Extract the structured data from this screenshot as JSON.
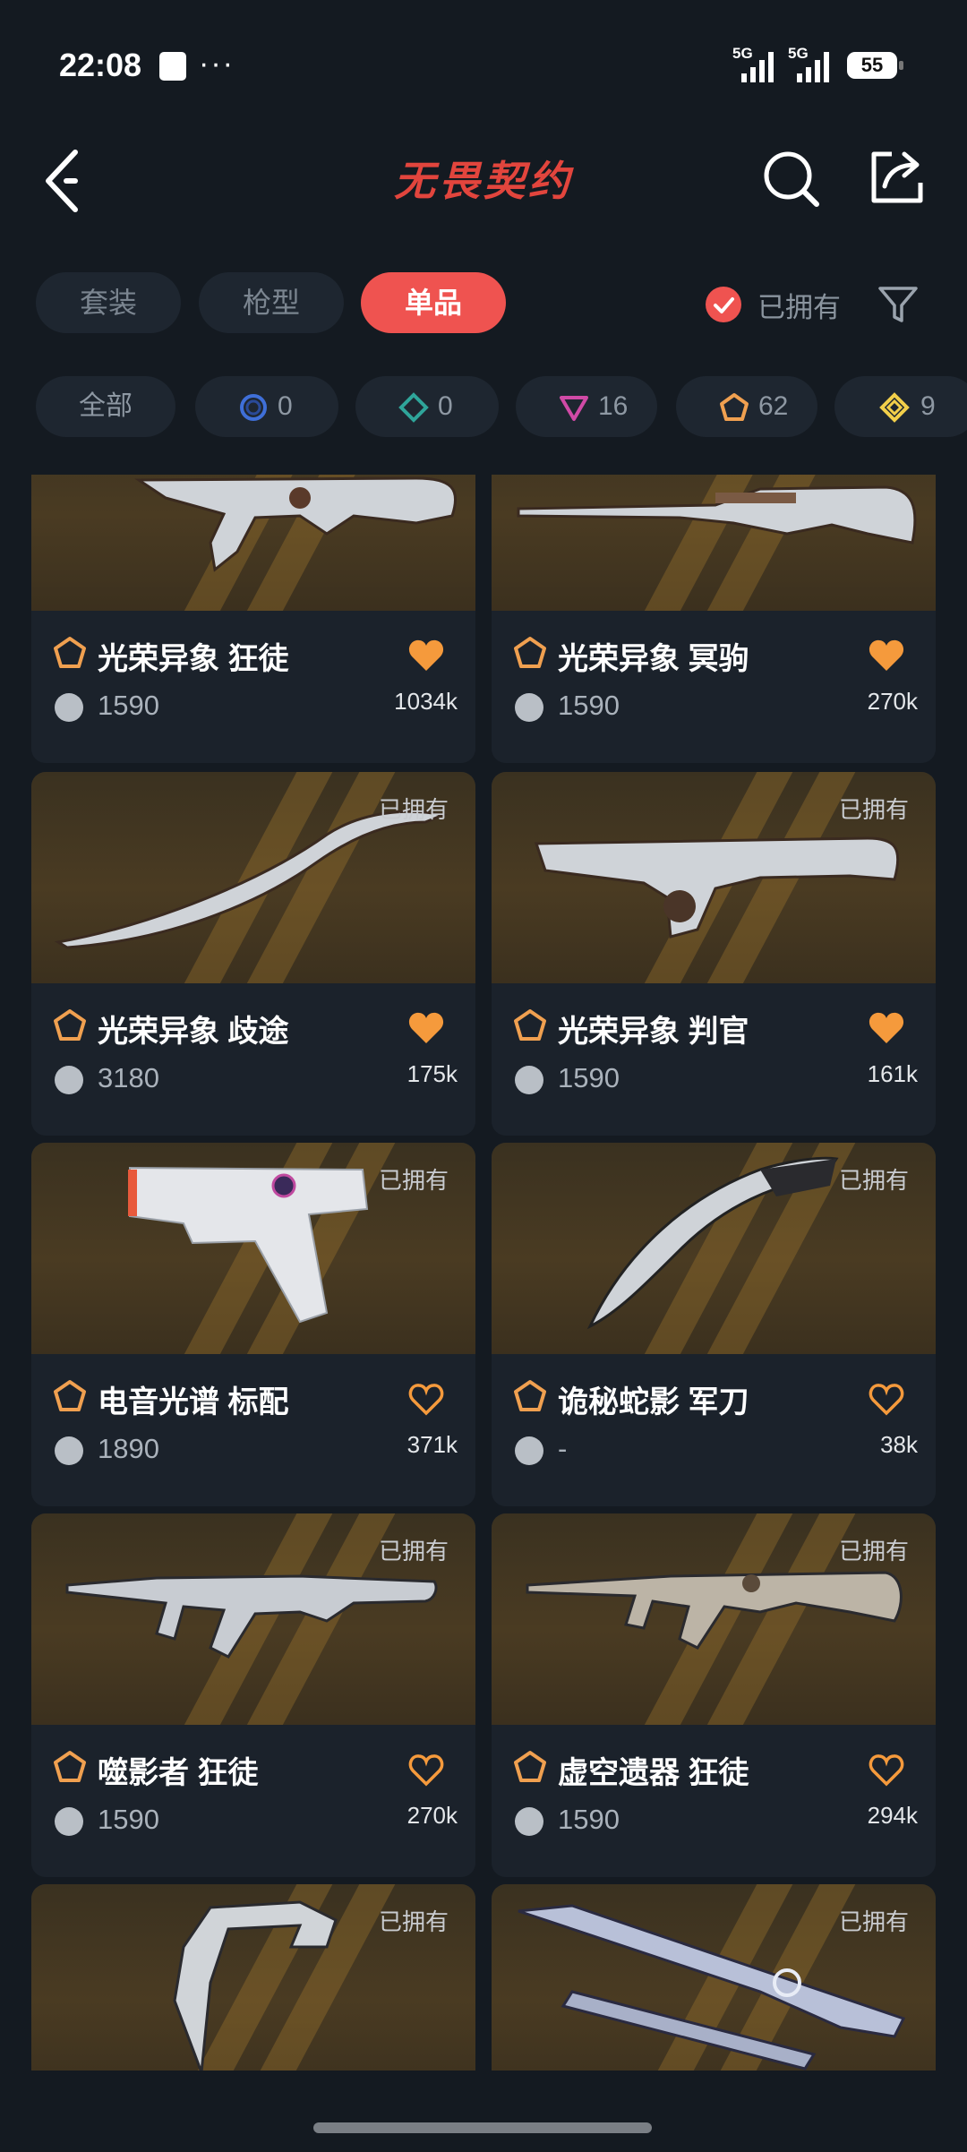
{
  "status": {
    "time": "22:08",
    "net1": "5G",
    "net2": "5G",
    "battery": "55"
  },
  "header": {
    "title": "无畏契约"
  },
  "tabs": [
    {
      "label": "套装"
    },
    {
      "label": "枪型"
    },
    {
      "label": "单品"
    }
  ],
  "owned_filter": {
    "label": "已拥有"
  },
  "rarity_filters": [
    {
      "label": "全部"
    },
    {
      "count": "0",
      "color": "#3f6fd8"
    },
    {
      "count": "0",
      "color": "#2fa59a"
    },
    {
      "count": "16",
      "color": "#d04aa6"
    },
    {
      "count": "62",
      "color": "#f0a050"
    },
    {
      "count": "9",
      "color": "#f2cf4a"
    }
  ],
  "skins": [
    {
      "name": "光荣异象 狂徒",
      "price": "1590",
      "likes": "1034k",
      "owned": "",
      "favorited": true
    },
    {
      "name": "光荣异象 冥驹",
      "price": "1590",
      "likes": "270k",
      "owned": "",
      "favorited": true
    },
    {
      "name": "光荣异象 歧途",
      "price": "3180",
      "likes": "175k",
      "owned": "已拥有",
      "favorited": true
    },
    {
      "name": "光荣异象 判官",
      "price": "1590",
      "likes": "161k",
      "owned": "已拥有",
      "favorited": true
    },
    {
      "name": "电音光谱 标配",
      "price": "1890",
      "likes": "371k",
      "owned": "已拥有",
      "favorited": false
    },
    {
      "name": "诡秘蛇影 军刀",
      "price": "-",
      "likes": "38k",
      "owned": "已拥有",
      "favorited": false
    },
    {
      "name": "噬影者 狂徒",
      "price": "1590",
      "likes": "270k",
      "owned": "已拥有",
      "favorited": false
    },
    {
      "name": "虚空遗器 狂徒",
      "price": "1590",
      "likes": "294k",
      "owned": "已拥有",
      "favorited": false
    },
    {
      "name": "",
      "price": "",
      "likes": "",
      "owned": "已拥有",
      "favorited": false
    },
    {
      "name": "",
      "price": "",
      "likes": "",
      "owned": "已拥有",
      "favorited": false
    }
  ],
  "colors": {
    "accent": "#ef5350",
    "rarity_premium": "#f0a050",
    "heart": "#f59a3c"
  }
}
